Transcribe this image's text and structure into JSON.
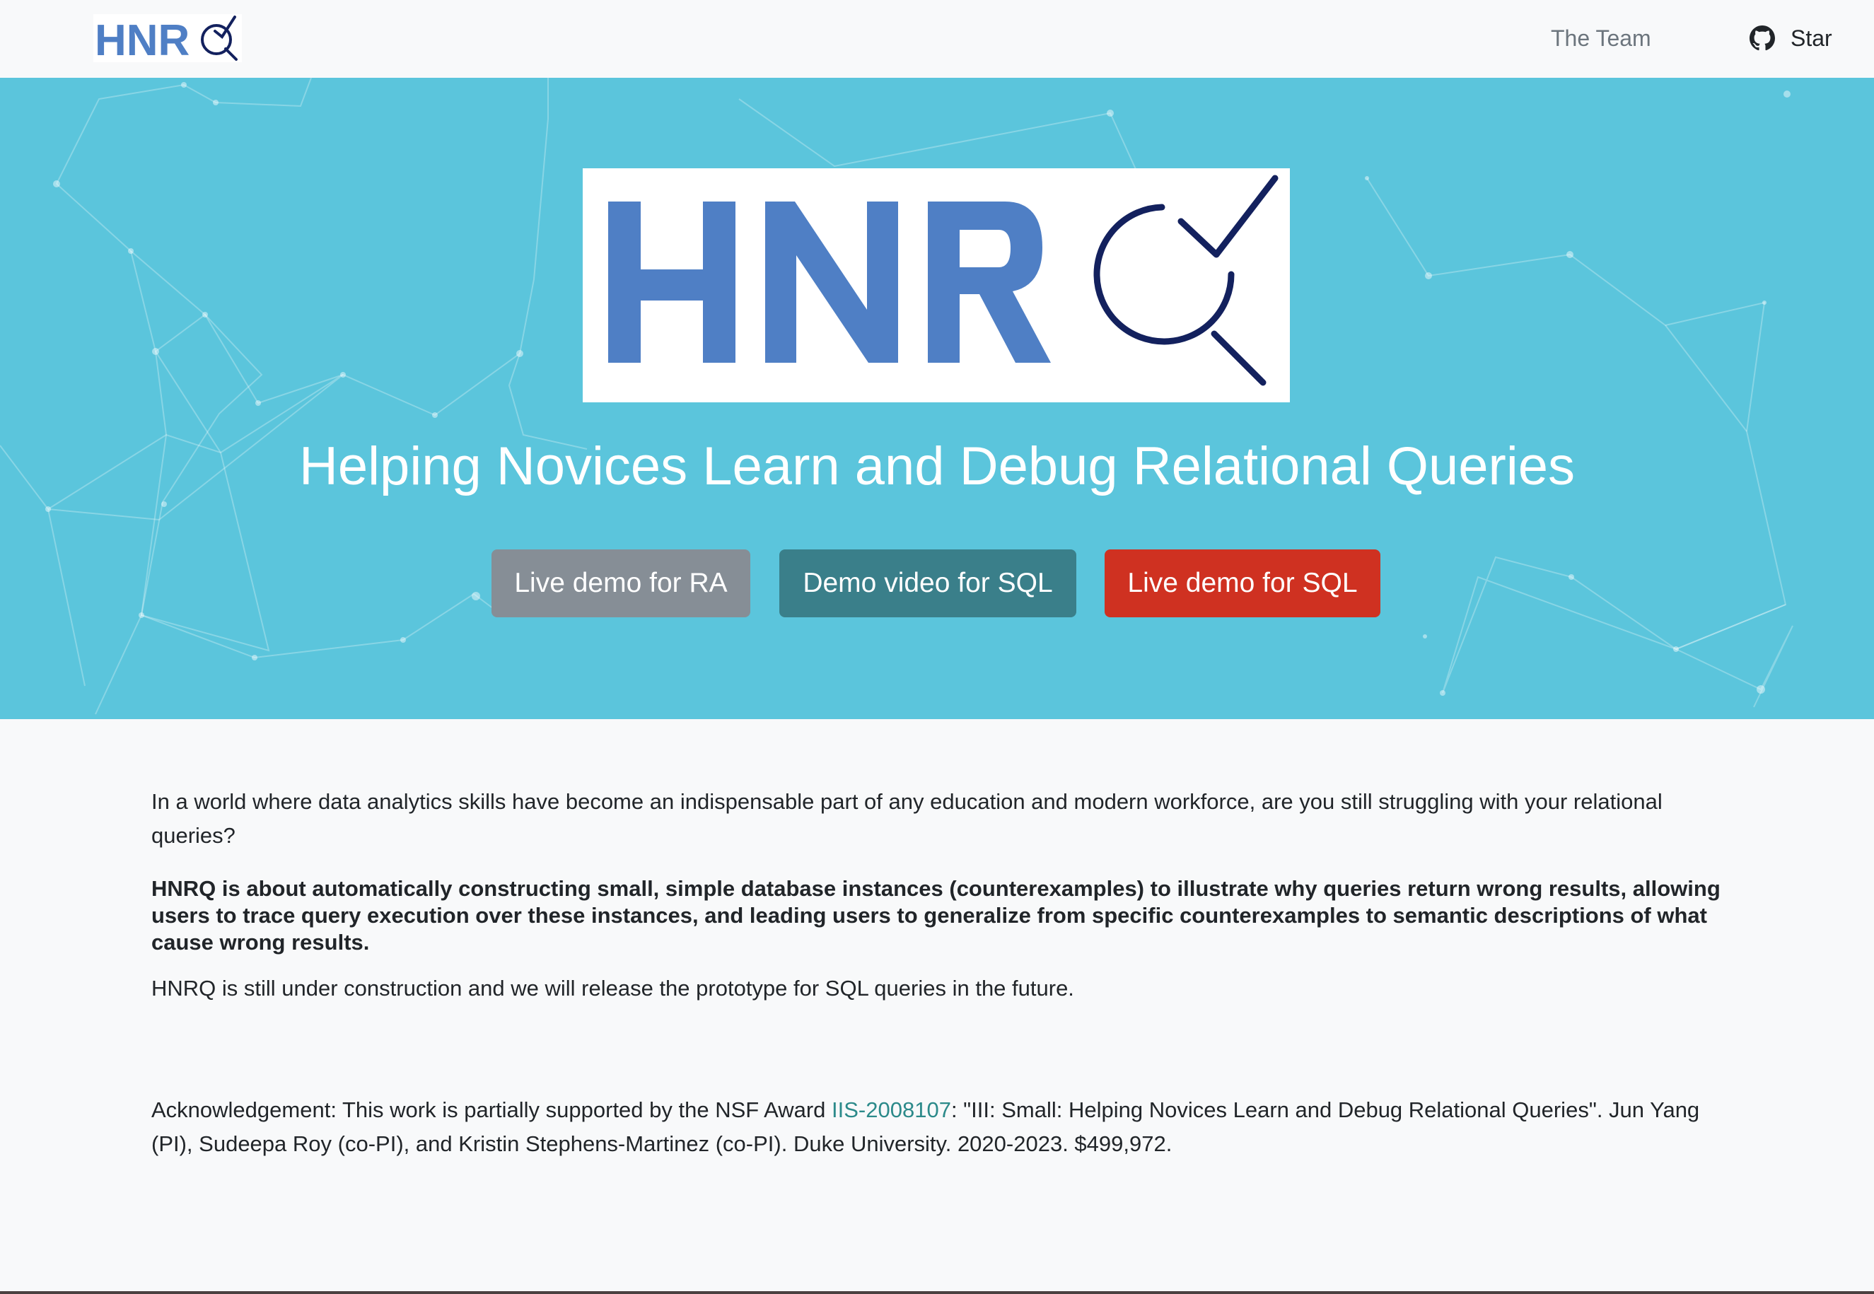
{
  "navbar": {
    "logo_alt": "HNRQ",
    "team_link": "The Team",
    "github_icon": "github-icon",
    "star_label": "Star"
  },
  "hero": {
    "logo_text": "HNR",
    "title": "Helping Novices Learn and Debug Relational Queries",
    "buttons": {
      "ra": "Live demo for RA",
      "video": "Demo video for SQL",
      "sql": "Live demo for SQL"
    }
  },
  "content": {
    "intro": "In a world where data analytics skills have become an indispensable part of any education and modern workforce, are you still struggling with your relational queries?",
    "about": "HNRQ is about automatically constructing small, simple database instances (counterexamples) to illustrate why queries return wrong results, allowing users to trace query execution over these instances, and leading users to generalize from specific counterexamples to semantic descriptions of what cause wrong results.",
    "status": "HNRQ is still under construction and we will release the prototype for SQL queries in the future.",
    "ack_prefix": "Acknowledgement: This work is partially supported by the NSF Award ",
    "ack_link": "IIS-2008107",
    "ack_suffix": ": \"III: Small: Helping Novices Learn and Debug Relational Queries\". Jun Yang (PI), Sudeepa Roy (co-PI), and Kristin Stephens-Martinez (co-PI). Duke University. 2020-2023. $499,972."
  },
  "colors": {
    "hero_bg": "#5bc5dc",
    "logo_blue": "#4f7fc5",
    "logo_navy": "#13215e",
    "btn_gray": "#868e96",
    "btn_teal": "#3a7f8a",
    "btn_red": "#cf3121",
    "link": "#2c8a8a"
  }
}
